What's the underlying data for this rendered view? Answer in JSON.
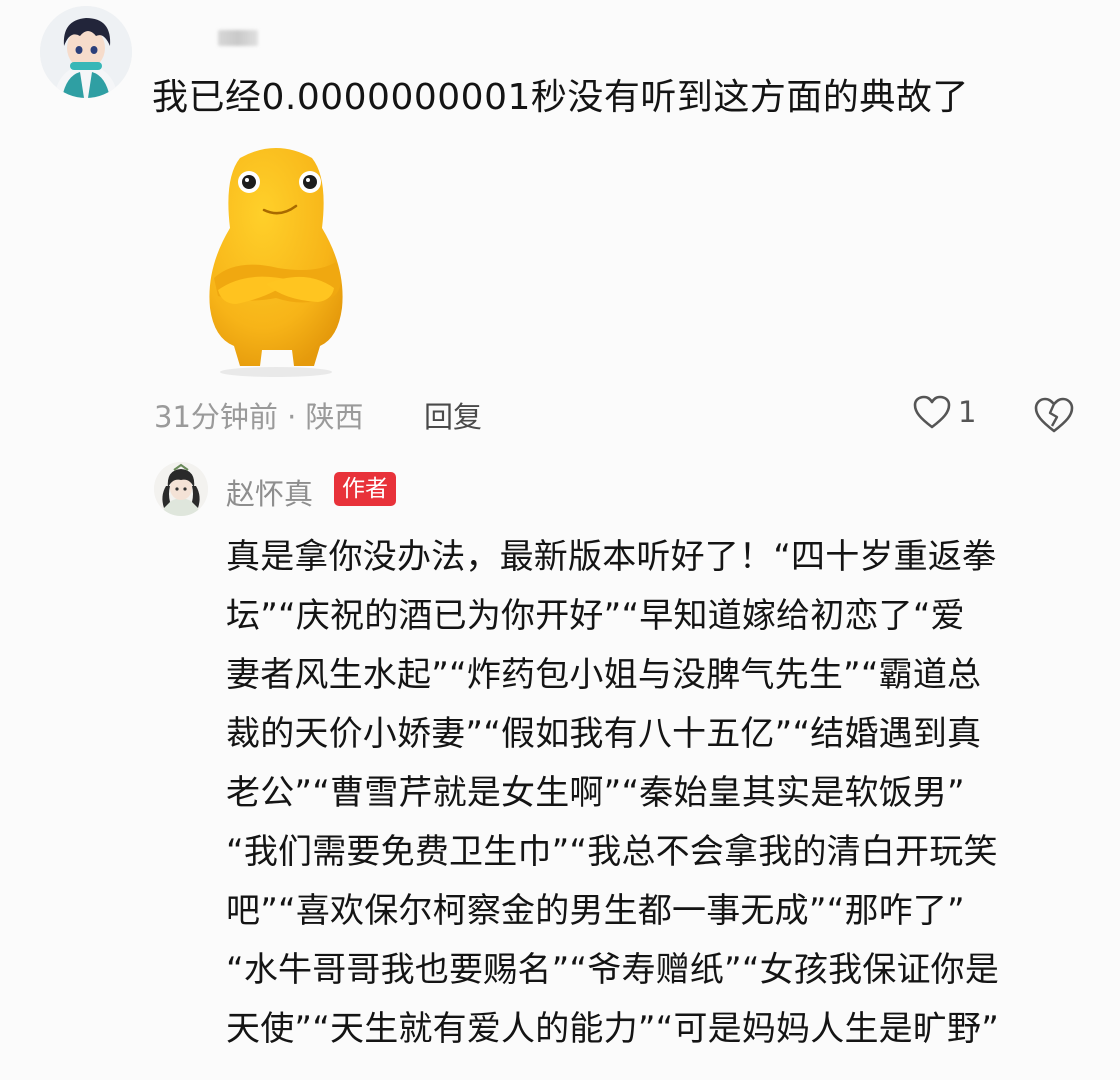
{
  "comment": {
    "text": "我已经0.0000000001秒没有听到这方面的典故了",
    "meta": "31分钟前 · 陕西",
    "reply_label": "回复",
    "like_count": "1"
  },
  "reply": {
    "author": "赵怀真",
    "badge": "作者",
    "lines": [
      "真是拿你没办法，最新版本听好了！“四十岁重返拳",
      "坛”“庆祝的酒已为你开好”“早知道嫁给初恋了“爱",
      "妻者风生水起”“炸药包小姐与没脾气先生”“霸道总",
      "裁的天价小娇妻”“假如我有八十五亿”“结婚遇到真",
      "老公”“曹雪芹就是女生啊”“秦始皇其实是软饭男”",
      "“我们需要免费卫生巾”“我总不会拿我的清白开玩笑",
      "吧”“喜欢保尔柯察金的男生都一事无成”“那咋了”",
      "“水牛哥哥我也要赐名”“爷寿赠纸”“女孩我保证你是",
      "天使”“天生就有爱人的能力”“可是妈妈人生是旷野”"
    ]
  },
  "colors": {
    "text": "#141414",
    "meta": "#9a9a9a",
    "badge": "#e8323a",
    "sticker": "#f7b418"
  }
}
